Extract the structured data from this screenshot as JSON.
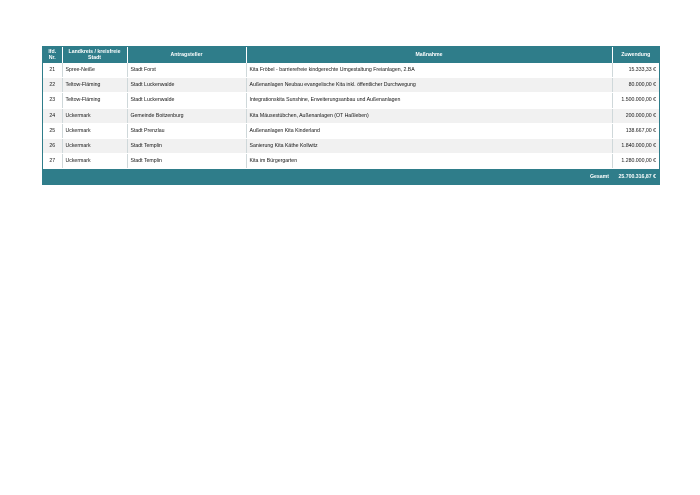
{
  "table": {
    "headers": {
      "nr": "lfd. Nr.",
      "landkreis": "Landkreis / kreisfreie Stadt",
      "antragsteller": "Antragsteller",
      "massnahme": "Maßnahme",
      "zuwendung": "Zuwendung"
    },
    "rows": [
      {
        "nr": "21",
        "landkreis": "Spree-Neiße",
        "antragsteller": "Stadt Forst",
        "massnahme": "Kita Fröbel - barrierefreie kindgerechte Umgestaltung Freianlagen, 2.BA",
        "zuwendung": "15.333,33 €"
      },
      {
        "nr": "22",
        "landkreis": "Teltow-Fläming",
        "antragsteller": "Stadt Luckenwalde",
        "massnahme": "Außenanlagen Neubau evangelische Kita inkl. öffentlicher Durchwegung",
        "zuwendung": "80.000,00 €"
      },
      {
        "nr": "23",
        "landkreis": "Teltow-Fläming",
        "antragsteller": "Stadt Luckenwalde",
        "massnahme": "Integrationskita Sunshine, Erweiterungsanbau und Außenanlagen",
        "zuwendung": "1.500.000,00 €"
      },
      {
        "nr": "24",
        "landkreis": "Uckermark",
        "antragsteller": "Gemeinde Boitzenburg",
        "massnahme": "Kita Mäusestübchen, Außenanlagen (OT Haßleben)",
        "zuwendung": "200.000,00 €"
      },
      {
        "nr": "25",
        "landkreis": "Uckermark",
        "antragsteller": "Stadt Prenzlau",
        "massnahme": "Außenanlagen Kita Kinderland",
        "zuwendung": "138.667,00 €"
      },
      {
        "nr": "26",
        "landkreis": "Uckermark",
        "antragsteller": "Stadt Templin",
        "massnahme": "Sanierung Kita Käthe Kollwitz",
        "zuwendung": "1.840.000,00 €"
      },
      {
        "nr": "27",
        "landkreis": "Uckermark",
        "antragsteller": "Stadt Templin",
        "massnahme": "Kita im Bürgergarten",
        "zuwendung": "1.280.000,00 €"
      }
    ],
    "footer": {
      "label": "Gesamt",
      "total": "25.700.316,87 €"
    }
  },
  "colors": {
    "header_bg": "#2f7d8a",
    "header_text": "#ffffff",
    "row_alt_bg": "#f1f1f1"
  }
}
